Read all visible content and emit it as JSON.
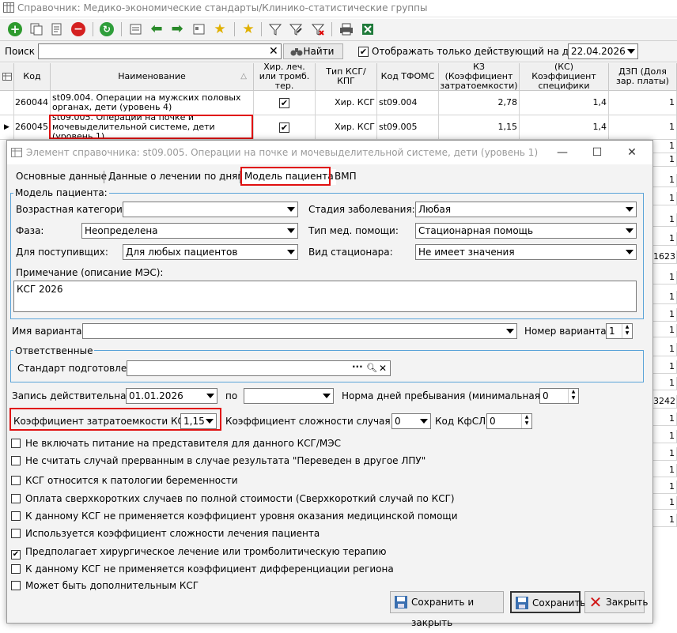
{
  "window": {
    "title": "Справочник: Медико-экономические стандарты/Клинико-статистические группы"
  },
  "search": {
    "label": "Поиск",
    "value": "",
    "find_label": "Найти",
    "only_active_label": "Отображать только действующий на дату:",
    "date": "22.04.2026"
  },
  "grid": {
    "headers": [
      "Код",
      "Наименование",
      "Хир. леч. или тромб. тер.",
      "Тип КСГ/КПГ",
      "Код ТФОМС",
      "КЗ (Коэффициент затратоемкости)",
      "(КС) Коэффициент специфики",
      "ДЗП (Доля зар. платы)"
    ],
    "rows": [
      {
        "code": "260044",
        "name": "st09.004. Операции на мужских половых органах, дети (уровень 4)",
        "check": "✔",
        "type": "Хир. КСГ",
        "tfoms": "st09.004",
        "kz": "2,78",
        "ks": "1,4",
        "dzp": "1"
      },
      {
        "code": "260045",
        "name": "st09.005. Операции на почке и мочевыделительной системе, дети (уровень 1)",
        "check": "✔",
        "type": "Хир. КСГ",
        "tfoms": "st09.005",
        "kz": "1,15",
        "ks": "1,4",
        "dzp": "1"
      }
    ],
    "right_col": [
      "1",
      "1",
      "1",
      "1",
      "1",
      "1",
      "1623",
      "1",
      "1",
      "1",
      "1",
      "1",
      "1",
      "1",
      "3242",
      "1",
      "1",
      "1",
      "1",
      "1",
      "1",
      "1"
    ]
  },
  "dialog": {
    "title": "Элемент справочника: st09.005. Операции на почке и мочевыделительной системе, дети (уровень 1)",
    "tabs": [
      "Основные данные",
      "Данные о лечении по дням",
      "Модель пациента",
      "ВМП"
    ],
    "patient_group": "Модель пациента:",
    "age_label": "Возрастная категория:",
    "age_value": "",
    "stage_label": "Стадия заболевания:",
    "stage_value": "Любая",
    "phase_label": "Фаза:",
    "phase_value": "Неопределена",
    "care_type_label": "Тип мед. помощи:",
    "care_type_value": "Стационарная помощь",
    "admitted_label": "Для поступивщих:",
    "admitted_value": "Для любых пациентов",
    "hospital_label": "Вид стационара:",
    "hospital_value": "Не имеет значения",
    "note_label": "Примечание (описание МЭС):",
    "note_value": "КСГ 2026",
    "variant_label": "Имя варианта:",
    "variant_value": "",
    "variant_no_label": "Номер варианта:",
    "variant_no_value": "1",
    "resp_group": "Ответственные",
    "standard_label": "Стандарт подготовлен:",
    "standard_value": "",
    "valid_from_label": "Запись действительна с:",
    "valid_from_value": "01.01.2026",
    "valid_to_label": "по",
    "valid_to_value": "",
    "min_days_label": "Норма дней пребывания (минимальная):",
    "min_days_value": "0",
    "kz_label": "Коэффициент затратоемкости КСГ:",
    "kz_value": "1,15",
    "ksc_label": "Коэффициент сложности случая:",
    "ksc_value": "0",
    "kfsl_label": "Код КфСЛ:",
    "kfsl_value": "0",
    "checkboxes": [
      {
        "label": "Не включать питание на представителя для данного КСГ/МЭС",
        "checked": ""
      },
      {
        "label": "Не считать случай прерванным в случае результата \"Переведен в другое ЛПУ\"",
        "checked": ""
      },
      {
        "label": "КСГ относится к патологии беременности",
        "checked": ""
      },
      {
        "label": "Оплата сверхкоротких случаев по полной стоимости (Сверхкороткий случай по КСГ)",
        "checked": ""
      },
      {
        "label": "К данному КСГ не применяется коэффициент уровня оказания медицинской помощи",
        "checked": ""
      },
      {
        "label": "Используется коэффициент сложности лечения пациента",
        "checked": ""
      },
      {
        "label": "Предполагает хирургическое лечение или тромболитическую терапию",
        "checked": "✔"
      },
      {
        "label": "К данному КСГ не применяется коэффициент дифференциации региона",
        "checked": ""
      },
      {
        "label": "Может быть дополнительным КСГ",
        "checked": ""
      }
    ],
    "save_close_label": "Сохранить и закрыть",
    "save_label": "Сохранить",
    "close_label": "Закрыть"
  },
  "colors": {
    "highlight": "#e01010",
    "group_border": "#5aa3d8"
  }
}
